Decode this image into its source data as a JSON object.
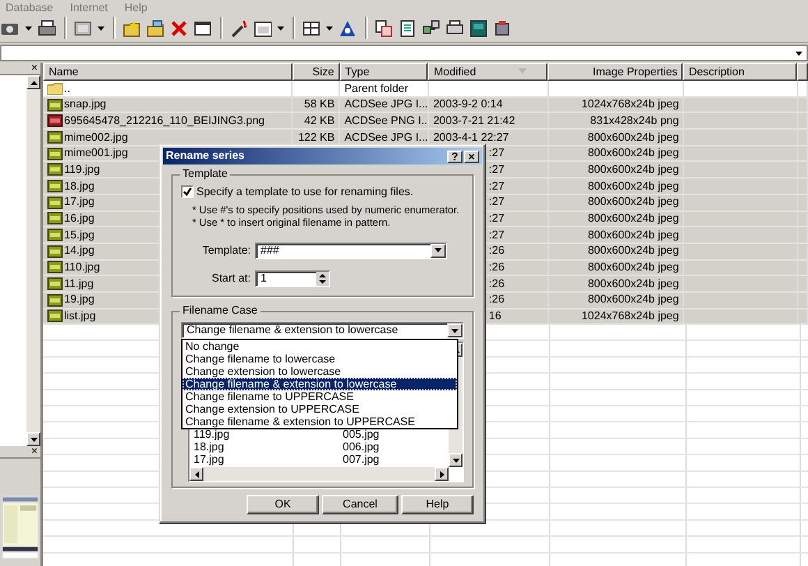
{
  "menu": [
    {
      "label": "Database"
    },
    {
      "label": "Internet"
    },
    {
      "label": "Help"
    }
  ],
  "folder_pane": {
    "close": "×"
  },
  "preview_pane": {
    "close": "×"
  },
  "file_list": {
    "columns": [
      "Name",
      "Size",
      "Type",
      "Modified",
      "Image Properties",
      "Description"
    ],
    "rows": [
      {
        "kind": "folder",
        "name": "..",
        "type": "Parent folder",
        "selected": false,
        "covered": false
      },
      {
        "kind": "jpg",
        "name": "snap.jpg",
        "size": "58 KB",
        "type": "ACDSee JPG I...",
        "modified": "2003-9-2 0:14",
        "properties": "1024x768x24b jpeg",
        "selected": true,
        "covered": false
      },
      {
        "kind": "png",
        "name": "695645478_212216_110_BEIJING3.png",
        "size": "42 KB",
        "type": "ACDSee PNG I...",
        "modified": "2003-7-21 21:42",
        "properties": "831x428x24b png",
        "selected": true,
        "covered": false
      },
      {
        "kind": "jpg",
        "name": "mime002.jpg",
        "size": "122 KB",
        "type": "ACDSee JPG I...",
        "modified": "2003-4-1 22:27",
        "properties": "800x600x24b jpeg",
        "selected": true,
        "covered": false
      },
      {
        "kind": "jpg",
        "name": "mime001.jpg",
        "modified": ":27",
        "properties": "800x600x24b jpeg",
        "selected": true,
        "covered": true
      },
      {
        "kind": "jpg",
        "name": "119.jpg",
        "modified": ":27",
        "properties": "800x600x24b jpeg",
        "selected": true,
        "covered": true
      },
      {
        "kind": "jpg",
        "name": "18.jpg",
        "modified": ":27",
        "properties": "800x600x24b jpeg",
        "selected": true,
        "covered": true
      },
      {
        "kind": "jpg",
        "name": "17.jpg",
        "modified": ":27",
        "properties": "800x600x24b jpeg",
        "selected": true,
        "covered": true
      },
      {
        "kind": "jpg",
        "name": "16.jpg",
        "modified": ":27",
        "properties": "800x600x24b jpeg",
        "selected": true,
        "covered": true
      },
      {
        "kind": "jpg",
        "name": "15.jpg",
        "modified": ":27",
        "properties": "800x600x24b jpeg",
        "selected": true,
        "covered": true
      },
      {
        "kind": "jpg",
        "name": "14.jpg",
        "modified": ":26",
        "properties": "800x600x24b jpeg",
        "selected": true,
        "covered": true
      },
      {
        "kind": "jpg",
        "name": "110.jpg",
        "modified": ":26",
        "properties": "800x600x24b jpeg",
        "selected": true,
        "covered": true
      },
      {
        "kind": "jpg",
        "name": "11.jpg",
        "modified": ":26",
        "properties": "800x600x24b jpeg",
        "selected": true,
        "covered": true
      },
      {
        "kind": "jpg",
        "name": "19.jpg",
        "modified": ":26",
        "properties": "800x600x24b jpeg",
        "selected": true,
        "covered": true
      },
      {
        "kind": "jpg",
        "name": "list.jpg",
        "modified": "16",
        "properties": "1024x768x24b jpeg",
        "selected": true,
        "covered": true
      }
    ]
  },
  "dialog": {
    "title": "Rename series",
    "help": "?",
    "close": "×",
    "template_group": {
      "label": "Template",
      "checkbox": {
        "label": "Specify a template to use for renaming files.",
        "checked": true
      },
      "hints": [
        "* Use #'s to specify positions used by numeric enumerator.",
        "* Use * to insert original filename in pattern."
      ],
      "template_label": "Template:",
      "template_value": "###",
      "start_label": "Start at:",
      "start_value": "1"
    },
    "case_group": {
      "label": "Filename Case",
      "value": "Change filename & extension to lowercase",
      "expanded": true,
      "options": [
        {
          "label": "No change",
          "selected": false
        },
        {
          "label": "Change filename to lowercase",
          "selected": false
        },
        {
          "label": "Change extension to lowercase",
          "selected": false
        },
        {
          "label": "Change filename & extension to lowercase",
          "selected": true
        },
        {
          "label": "Change filename to UPPERCASE",
          "selected": false
        },
        {
          "label": "Change extension to UPPERCASE",
          "selected": false
        },
        {
          "label": "Change filename & extension to UPPERCASE",
          "selected": false
        }
      ],
      "preview_rows": [
        [
          "119.jpg",
          "005.jpg"
        ],
        [
          "18.jpg",
          "006.jpg"
        ],
        [
          "17.jpg",
          "007.jpg"
        ]
      ]
    },
    "buttons": [
      "OK",
      "Cancel",
      "Help"
    ]
  }
}
